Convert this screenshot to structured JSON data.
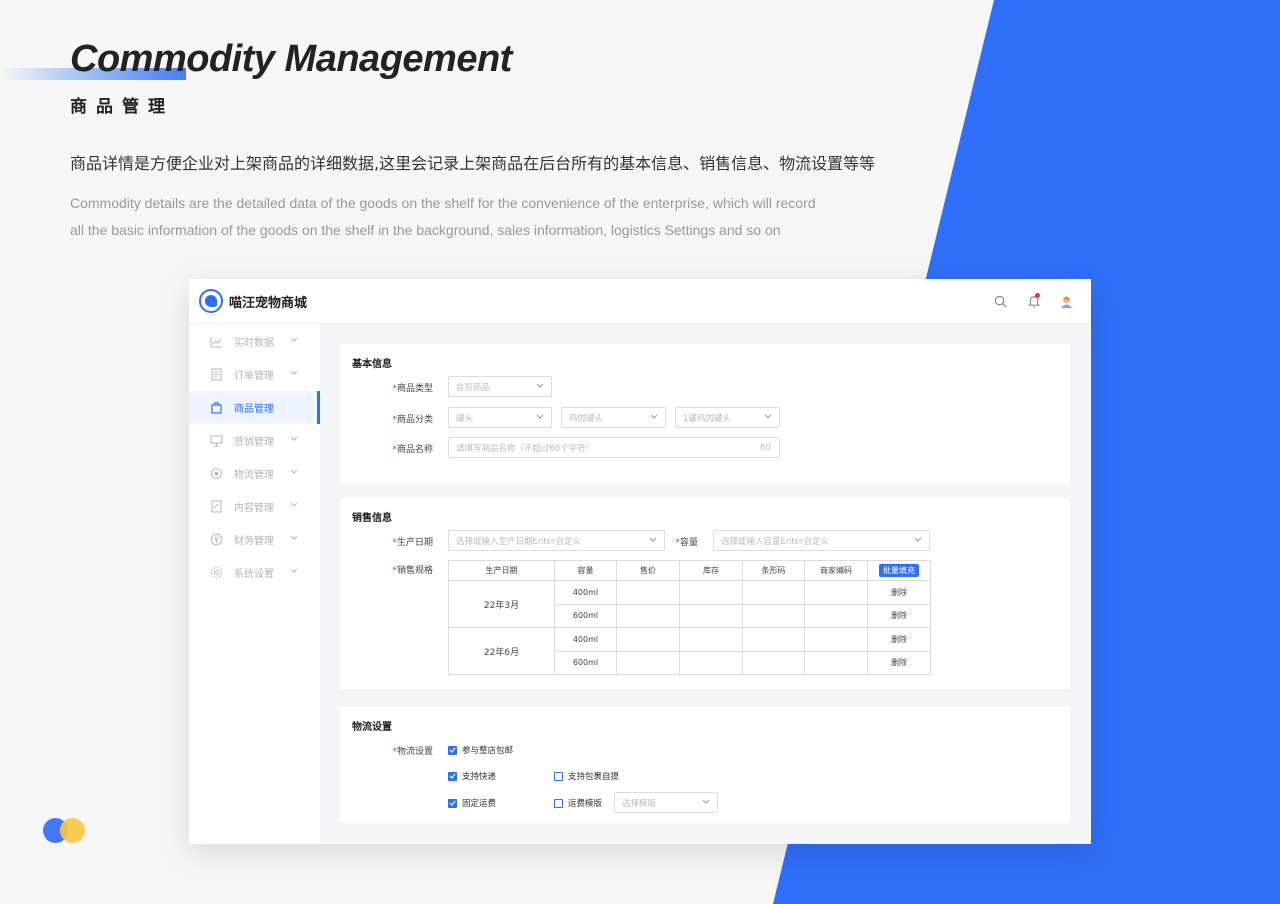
{
  "hero": {
    "title": "Commodity Management",
    "subtitle": "商品管理",
    "description_cn": "商品详情是方便企业对上架商品的详细数据,这里会记录上架商品在后台所有的基本信息、销售信息、物流设置等等",
    "description_en_line1": "Commodity details are the detailed data of the goods on the shelf for the convenience of the enterprise, which will record",
    "description_en_line2": "all the basic information of the goods on the shelf in the background, sales information, logistics Settings and so on"
  },
  "colors": {
    "accent": "#2f6ff7",
    "dot_blue": "#4479f5",
    "dot_yellow": "#f7c744"
  },
  "app": {
    "name": "喵汪宠物商城",
    "icons": [
      "search-icon",
      "bell-icon",
      "avatar"
    ],
    "sidebar": [
      {
        "label": "实时数据",
        "icon": "chart-line-icon",
        "active": false
      },
      {
        "label": "订单管理",
        "icon": "document-icon",
        "active": false
      },
      {
        "label": "商品管理",
        "icon": "bag-icon",
        "active": true
      },
      {
        "label": "营销管理",
        "icon": "presentation-icon",
        "active": false
      },
      {
        "label": "物流管理",
        "icon": "location-icon",
        "active": false
      },
      {
        "label": "内容管理",
        "icon": "file-edit-icon",
        "active": false
      },
      {
        "label": "财务管理",
        "icon": "yen-icon",
        "active": false
      },
      {
        "label": "系统设置",
        "icon": "gear-icon",
        "active": false
      }
    ]
  },
  "basic": {
    "title": "基本信息",
    "type_label": "商品类型",
    "type_value": "会员商品",
    "category_label": "商品分类",
    "category_1": "罐头",
    "category_2": "鸡肉罐头",
    "category_3": "1罐鸡肉罐头",
    "name_label": "商品名称",
    "name_placeholder": "请填写商品名称（不超过60个字符）",
    "name_count": "60"
  },
  "sales": {
    "title": "销售信息",
    "date_label": "生产日期",
    "date_placeholder": "选择或输入生产日期Enter自定义",
    "capacity_label": "容量",
    "capacity_placeholder": "选择或输入容量Enter自定义",
    "spec_label": "销售规格",
    "headers": [
      "生产日期",
      "容量",
      "售价",
      "库存",
      "条形码",
      "商家编码"
    ],
    "batch_button": "批量填充",
    "rows": [
      {
        "date": "22年3月",
        "capacity_1": "400ml",
        "capacity_2": "600ml"
      },
      {
        "date": "22年6月",
        "capacity_1": "400ml",
        "capacity_2": "600ml"
      }
    ],
    "delete_label": "删除"
  },
  "logistics": {
    "title": "物流设置",
    "label": "物流设置",
    "options": {
      "free_shipping": {
        "label": "参与整店包邮",
        "checked": true
      },
      "express": {
        "label": "支持快递",
        "checked": true
      },
      "pickup": {
        "label": "支持包裹自提",
        "checked": false
      },
      "fixed_freight": {
        "label": "固定运费",
        "checked": true
      },
      "freight_template": {
        "label": "运费模版",
        "checked": false
      }
    },
    "template_placeholder": "选择模版"
  }
}
